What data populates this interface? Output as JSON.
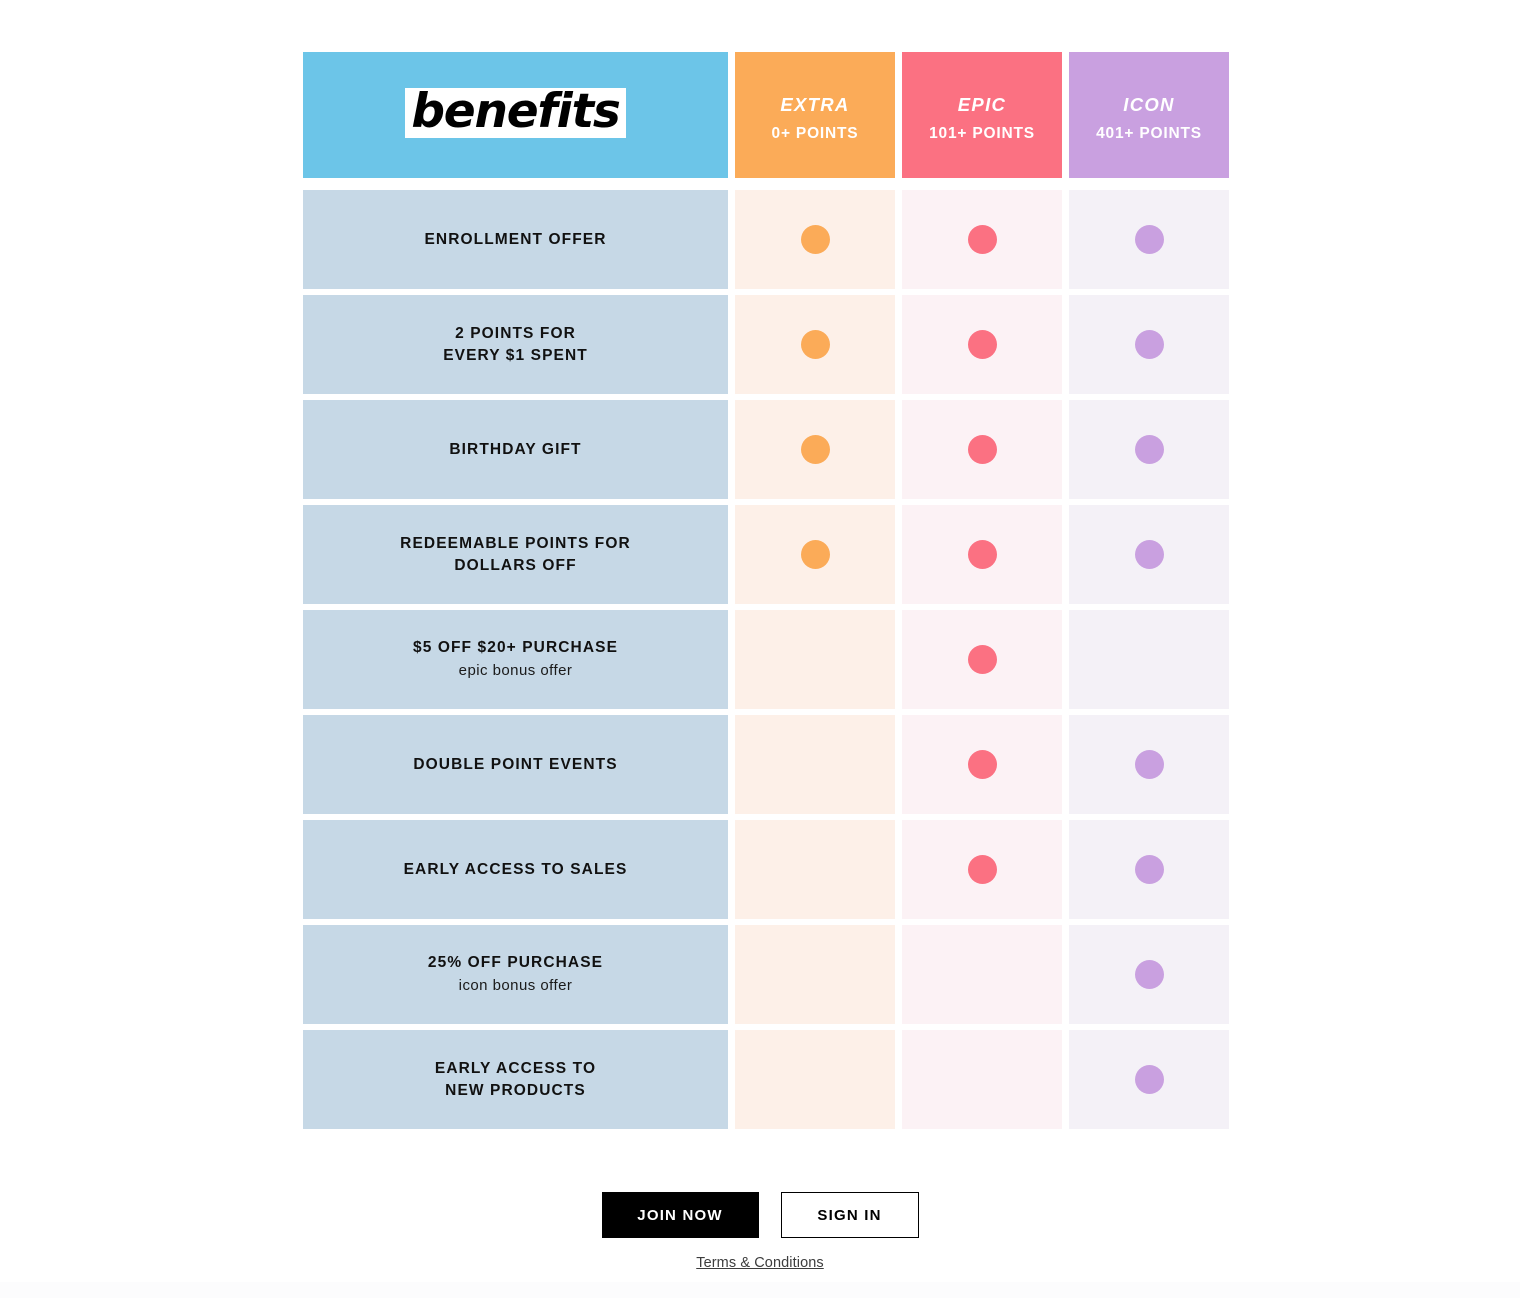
{
  "brand": {
    "wordmark": "benefits"
  },
  "colors": {
    "brand_blue": "#6cc5e8",
    "label_blue": "#c6d8e6",
    "extra": "#fbab58",
    "epic": "#fb7182",
    "icon": "#c9a0e0",
    "extra_cell": "#fdf0e8",
    "epic_cell": "#fcf2f5",
    "icon_cell": "#f4f1f7",
    "black": "#000000"
  },
  "tiers": [
    {
      "key": "extra",
      "name": "EXTRA",
      "points": "0+ POINTS",
      "header_bg": "#fbab58",
      "cell_bg": "#fdf0e8",
      "dot": "#fbab58"
    },
    {
      "key": "epic",
      "name": "EPIC",
      "points": "101+ POINTS",
      "header_bg": "#fb7182",
      "cell_bg": "#fcf2f5",
      "dot": "#fb7182"
    },
    {
      "key": "icon",
      "name": "ICON",
      "points": "401+ POINTS",
      "header_bg": "#c9a0e0",
      "cell_bg": "#f4f1f7",
      "dot": "#c9a0e0"
    }
  ],
  "rows": [
    {
      "label": "ENROLLMENT OFFER",
      "sub": "",
      "extra": true,
      "epic": true,
      "icon": true
    },
    {
      "label": "2 POINTS FOR\nEVERY $1 SPENT",
      "sub": "",
      "extra": true,
      "epic": true,
      "icon": true
    },
    {
      "label": "BIRTHDAY GIFT",
      "sub": "",
      "extra": true,
      "epic": true,
      "icon": true
    },
    {
      "label": "REDEEMABLE POINTS FOR\nDOLLARS OFF",
      "sub": "",
      "extra": true,
      "epic": true,
      "icon": true
    },
    {
      "label": "$5 OFF $20+ PURCHASE",
      "sub": "epic bonus offer",
      "extra": false,
      "epic": true,
      "icon": false
    },
    {
      "label": "DOUBLE POINT EVENTS",
      "sub": "",
      "extra": false,
      "epic": true,
      "icon": true
    },
    {
      "label": "EARLY ACCESS TO SALES",
      "sub": "",
      "extra": false,
      "epic": true,
      "icon": true
    },
    {
      "label": "25% OFF PURCHASE",
      "sub": "icon bonus offer",
      "extra": false,
      "epic": false,
      "icon": true
    },
    {
      "label": "EARLY ACCESS TO\nNEW PRODUCTS",
      "sub": "",
      "extra": false,
      "epic": false,
      "icon": true
    }
  ],
  "footer": {
    "join_label": "JOIN NOW",
    "signin_label": "SIGN IN",
    "terms_label": "Terms & Conditions"
  }
}
